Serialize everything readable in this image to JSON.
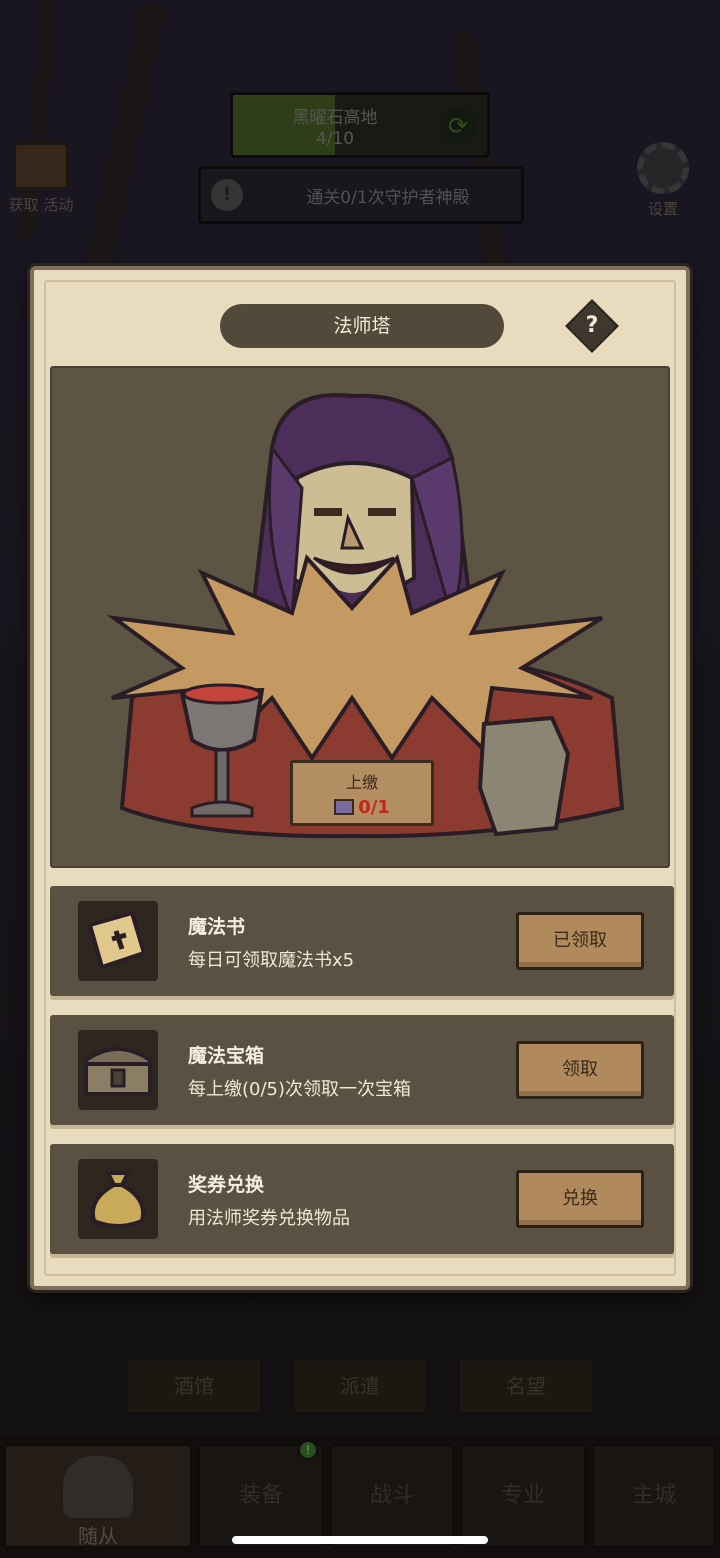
{
  "background": {
    "region": {
      "name": "黑曜石高地",
      "progress": "4/10",
      "progress_fraction": 0.4,
      "cycle_icon": "cycle-arrows-icon"
    },
    "quest": {
      "text": "通关0/1次守护者神殿",
      "alert_icon": "exclamation-icon"
    },
    "left_icon": {
      "label": "获取 活动",
      "icon": "scroll-board-icon"
    },
    "settings": {
      "label": "设置",
      "icon": "gear-icon"
    },
    "sub_tabs": [
      "酒馆",
      "派遣",
      "名望"
    ],
    "bottom_nav": [
      {
        "label": "随从",
        "icon": "helmet-icon",
        "active": true
      },
      {
        "label": "装备",
        "active": false
      },
      {
        "label": "战斗",
        "active": false
      },
      {
        "label": "专业",
        "active": false
      },
      {
        "label": "主城",
        "active": false
      }
    ],
    "badge_icon": "notification-dot-icon"
  },
  "modal": {
    "title": "法师塔",
    "help_label": "?",
    "tribute": {
      "label": "上缴",
      "count": "0/1",
      "icon": "book-stack-icon"
    },
    "items": [
      {
        "title": "魔法书",
        "desc": "每日可领取魔法书x5",
        "button": "已领取",
        "icon": "spellbook-icon"
      },
      {
        "title": "魔法宝箱",
        "desc": "每上缴(0/5)次领取一次宝箱",
        "button": "领取",
        "icon": "treasure-chest-icon"
      },
      {
        "title": "奖券兑换",
        "desc": "用法师奖券兑换物品",
        "button": "兑换",
        "icon": "coin-bag-icon"
      }
    ]
  },
  "colors": {
    "panel": "#e9dcbe",
    "row_bg": "#5a5142",
    "button": "#b08a5d",
    "tribute_count": "#c2271c",
    "region_fill": "#4e6b25"
  }
}
